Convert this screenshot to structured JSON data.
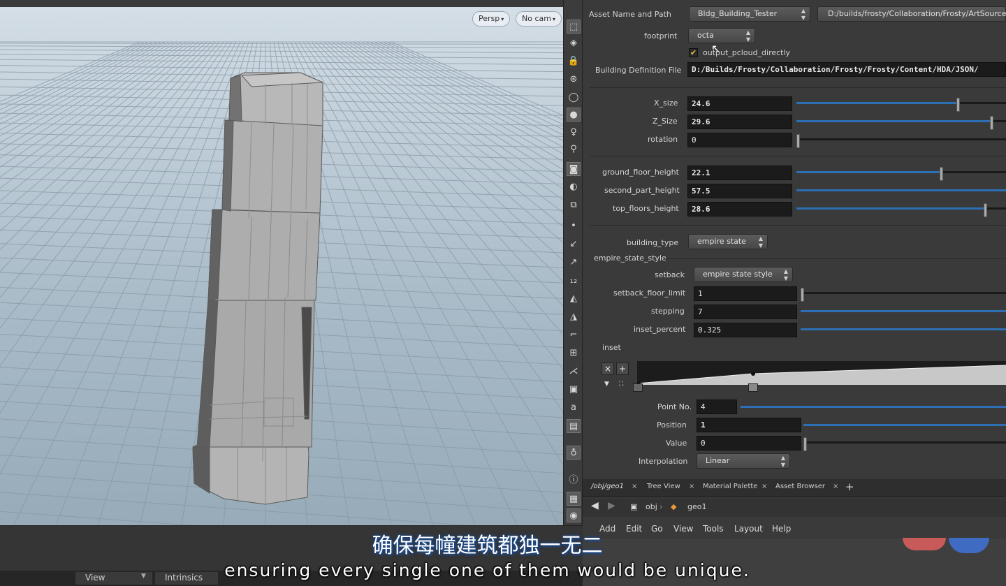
{
  "viewport": {
    "persp_label": "Persp",
    "nocam_label": "No cam"
  },
  "params": {
    "asset_name_label": "Asset Name and Path",
    "asset_name": "Bldg_Building_Tester",
    "asset_path": "D:/builds/frosty/Collaboration/Frosty/ArtSource/l",
    "footprint_label": "footprint",
    "footprint_value": "octa",
    "output_checkbox_label": "output_pcloud_directly",
    "output_checked": true,
    "building_def_label": "Building Definition File",
    "building_def_value": "D:/Builds/Frosty/Collaboration/Frosty/Frosty/Content/HDA/JSON/",
    "x_size_label": "X_size",
    "x_size_value": "24.6",
    "x_size_fraction": 0.77,
    "z_size_label": "Z_Size",
    "z_size_value": "29.6",
    "z_size_fraction": 0.93,
    "rotation_label": "rotation",
    "rotation_value": "0",
    "rotation_fraction": 0.0,
    "ground_floor_label": "ground_floor_height",
    "ground_floor_value": "22.1",
    "ground_floor_fraction": 0.69,
    "second_part_label": "second_part_height",
    "second_part_value": "57.5",
    "second_part_fraction": 1.0,
    "top_floors_label": "top_floors_height",
    "top_floors_value": "28.6",
    "top_floors_fraction": 0.9,
    "building_type_label": "building_type",
    "building_type_value": "empire state",
    "empire_group_label": "empire_state_style",
    "setback_label": "setback",
    "setback_value": "empire state style",
    "setback_floor_limit_label": "setback_floor_limit",
    "setback_floor_limit_value": "1",
    "setback_floor_limit_fraction": 0.0,
    "stepping_label": "stepping",
    "stepping_value": "7",
    "stepping_fraction": 1.0,
    "inset_percent_label": "inset_percent",
    "inset_percent_value": "0.325",
    "inset_percent_fraction": 1.0,
    "inset_label": "inset",
    "point_no_label": "Point No.",
    "point_no_value": "4",
    "position_label": "Position",
    "position_value": "1",
    "value_label": "Value",
    "value_value": "0",
    "interpolation_label": "Interpolation",
    "interpolation_value": "Linear"
  },
  "network": {
    "tabs": [
      {
        "label": "/obj/geo1"
      },
      {
        "label": "Tree View"
      },
      {
        "label": "Material Palette"
      },
      {
        "label": "Asset Browser"
      }
    ],
    "add_tab": "+",
    "path_obj": "obj",
    "path_geo": "geo1",
    "menu": [
      "Add",
      "Edit",
      "Go",
      "View",
      "Tools",
      "Layout",
      "Help"
    ]
  },
  "status": {
    "view_label": "View",
    "intrinsics_label": "Intrinsics"
  },
  "subtitles": {
    "chinese": "确保每幢建筑都独一无二",
    "english": "ensuring every single one of them would be unique."
  },
  "colors": {
    "slider_fill": "#2d6fb5",
    "subtitle_outline": "#1d4a8a"
  }
}
